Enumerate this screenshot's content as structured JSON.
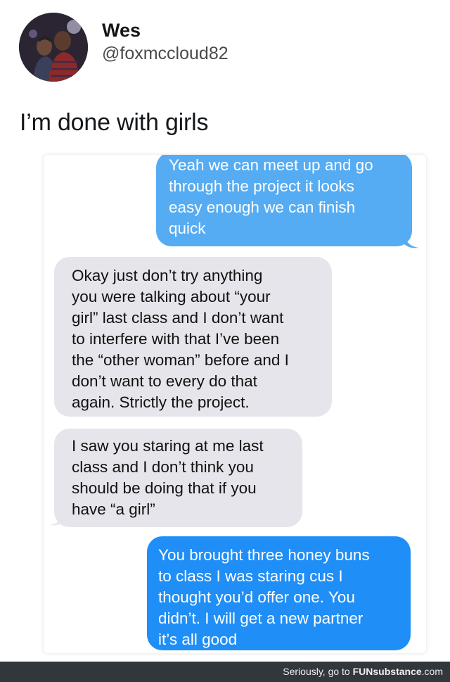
{
  "tweet": {
    "name": "Wes",
    "handle": "@foxmccloud82",
    "text": "I’m done with girls"
  },
  "messages": [
    {
      "direction": "outgoing",
      "lines": [
        "Yeah we can meet up and go",
        "through the project it looks",
        "easy enough we can finish",
        "quick"
      ]
    },
    {
      "direction": "incoming",
      "lines": [
        "Okay just don’t try anything",
        "you were talking about “your",
        "girl” last class and I don’t want",
        "to interfere with that I’ve been",
        "the “other woman” before and I",
        "don’t want to every do that",
        "again. Strictly the project."
      ]
    },
    {
      "direction": "incoming",
      "lines": [
        "I saw you staring at me last",
        "class and I don’t think you",
        "should be doing that if you",
        "have “a girl”"
      ]
    },
    {
      "direction": "outgoing",
      "lines": [
        "You brought three honey buns",
        "to class I was staring cus I",
        "thought you’d offer one. You",
        "didn’t. I will get a new partner",
        "it’s all good"
      ]
    }
  ],
  "footer": {
    "prefix": "Seriously, go to ",
    "brand": "FUNsubstance",
    "suffix": ".com"
  },
  "colors": {
    "outgoing_light": "#56acf2",
    "outgoing": "#1f8ef7",
    "incoming": "#e6e5eb",
    "footer_bg": "#32373c"
  }
}
